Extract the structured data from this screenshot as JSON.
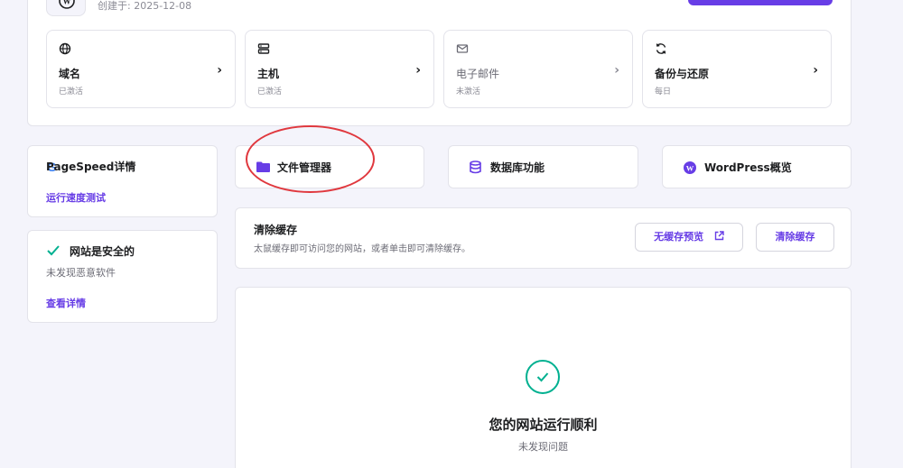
{
  "site": {
    "created_label": "创建于:  2025-12-08"
  },
  "services": [
    {
      "name": "域名",
      "status": "已激活",
      "icon": "globe-icon"
    },
    {
      "name": "主机",
      "status": "已激活",
      "icon": "server-icon"
    },
    {
      "name": "电子邮件",
      "status": "未激活",
      "icon": "mail-icon"
    },
    {
      "name": "备份与还原",
      "status": "每日",
      "icon": "refresh-icon"
    }
  ],
  "pagespeed": {
    "title": "PageSpeed详情",
    "link": "运行速度测试",
    "icon": "google-g-icon"
  },
  "security": {
    "title": "网站是安全的",
    "subtitle": "未发现恶意软件",
    "link": "查看详情",
    "icon": "check-icon"
  },
  "quick_actions": [
    {
      "label": "文件管理器",
      "icon": "folder-icon"
    },
    {
      "label": "数据库功能",
      "icon": "database-icon"
    },
    {
      "label": "WordPress概览",
      "icon": "wordpress-icon"
    }
  ],
  "cache": {
    "title": "清除缓存",
    "description": "太鼠缓存即可访问您的网站，或者单击即可清除缓存。",
    "preview_button": "无缓存预览",
    "clear_button": "清除缓存"
  },
  "status": {
    "title": "您的网站运行顺利",
    "subtitle": "未发现问题"
  },
  "colors": {
    "accent": "#673de6",
    "success": "#00b090",
    "annotation": "#e0383e"
  }
}
